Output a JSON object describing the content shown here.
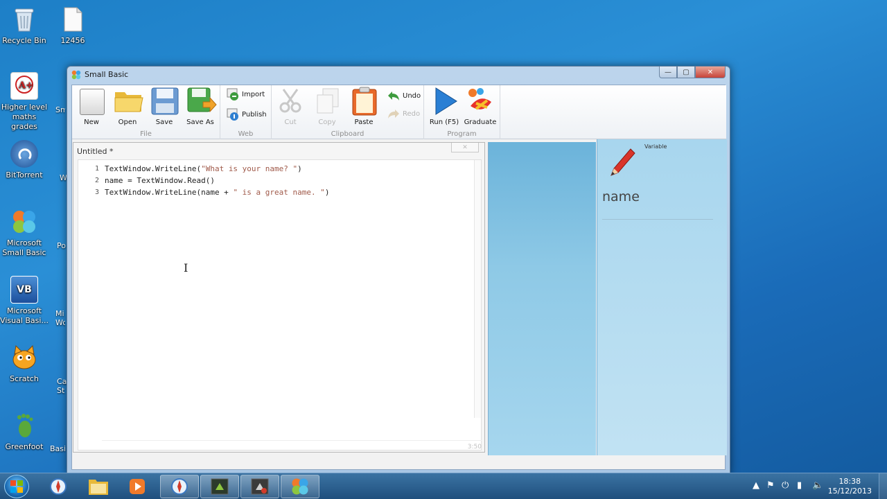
{
  "desktop": {
    "icons": [
      {
        "label": "Recycle Bin"
      },
      {
        "label": "12456"
      },
      {
        "label": "Higher level maths grades"
      },
      {
        "label": "BitTorrent"
      },
      {
        "label": "Microsoft Small Basic"
      },
      {
        "label": "Microsoft Visual Basi..."
      },
      {
        "label": "Scratch"
      },
      {
        "label": "Greenfoot"
      }
    ],
    "peek_labels": [
      "Sm",
      "W",
      "Po",
      "Mi Wo",
      "Ca St",
      "Basi"
    ]
  },
  "window": {
    "title": "Small Basic",
    "controls": {
      "minimize": "—",
      "maximize": "▢",
      "close": "✕"
    }
  },
  "ribbon": {
    "groups": {
      "file": {
        "label": "File",
        "new": "New",
        "open": "Open",
        "save": "Save",
        "save_as": "Save As"
      },
      "web": {
        "label": "Web",
        "import": "Import",
        "publish": "Publish"
      },
      "clipboard": {
        "label": "Clipboard",
        "cut": "Cut",
        "copy": "Copy",
        "paste": "Paste",
        "undo": "Undo",
        "redo": "Redo"
      },
      "program": {
        "label": "Program",
        "run": "Run (F5)",
        "graduate": "Graduate"
      }
    }
  },
  "editor": {
    "title": "Untitled *",
    "close_tab": "✕",
    "lines": [
      {
        "num": "1",
        "pre": "TextWindow.WriteLine(",
        "str": "\"What is your name? \"",
        "post": ")"
      },
      {
        "num": "2",
        "pre": "name = TextWindow.Read()",
        "str": "",
        "post": ""
      },
      {
        "num": "3",
        "pre": "TextWindow.WriteLine(name + ",
        "str": "\" is a great name. \"",
        "post": ")"
      }
    ],
    "cursor_pos": "3:50"
  },
  "side_panel": {
    "kind": "Variable",
    "name": "name"
  },
  "taskbar": {
    "time": "18:38",
    "date": "15/12/2013"
  },
  "colors": {
    "desktop": "#1d7fc7",
    "string_literal": "#a05a4a",
    "run_blue": "#2a7fd4"
  }
}
